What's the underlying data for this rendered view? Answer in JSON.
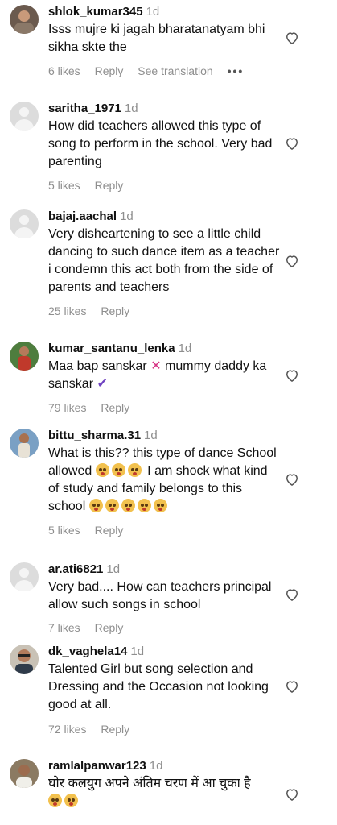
{
  "comments": [
    {
      "username": "shlok_kumar345",
      "time": "1d",
      "text": "Isss mujre ki jagah bharatanatyam bhi sikha skte the",
      "likes": "6 likes",
      "reply": "Reply",
      "extra": "See translation",
      "avatar": "photo-avatar"
    },
    {
      "username": "saritha_1971",
      "time": "1d",
      "text": "How did teachers allowed this type of song to perform in the school. Very bad parenting",
      "likes": "5 likes",
      "reply": "Reply",
      "avatar": "default-avatar"
    },
    {
      "username": "bajaj.aachal",
      "time": "1d",
      "text": "Very disheartening to see a little child dancing to such dance item as a teacher i condemn this act both from the side of parents and teachers",
      "likes": "25 likes",
      "reply": "Reply",
      "avatar": "default-avatar"
    },
    {
      "username": "kumar_santanu_lenka",
      "time": "1d",
      "text_part1": "Maa bap sanskar",
      "text_part2": "mummy daddy ka sanskar",
      "likes": "79 likes",
      "reply": "Reply",
      "avatar": "photo-avatar"
    },
    {
      "username": "bittu_sharma.31",
      "time": "1d",
      "text_part1": "What is this?? this type of dance School allowed",
      "text_part2": "I am shock what kind of study and family belongs to this school",
      "likes": "5 likes",
      "reply": "Reply",
      "avatar": "photo-avatar"
    },
    {
      "username": "ar.ati6821",
      "time": "1d",
      "text": "Very bad.... How can teachers principal allow such songs in school",
      "likes": "7 likes",
      "reply": "Reply",
      "avatar": "default-avatar"
    },
    {
      "username": "dk_vaghela14",
      "time": "1d",
      "text": "Talented Girl but song selection and Dressing and the Occasion not looking good at all.",
      "likes": "72 likes",
      "reply": "Reply",
      "avatar": "photo-avatar"
    },
    {
      "username": "ramlalpanwar123",
      "time": "1d",
      "text": "घोर कलयुग अपने अंतिम चरण में आ चुका है",
      "avatar": "photo-avatar"
    }
  ],
  "colors": {
    "text": "#111111",
    "muted": "#8e8e8e",
    "background": "#ffffff"
  },
  "icons": {
    "like": "heart-outline-icon",
    "more": "more-options-icon"
  }
}
